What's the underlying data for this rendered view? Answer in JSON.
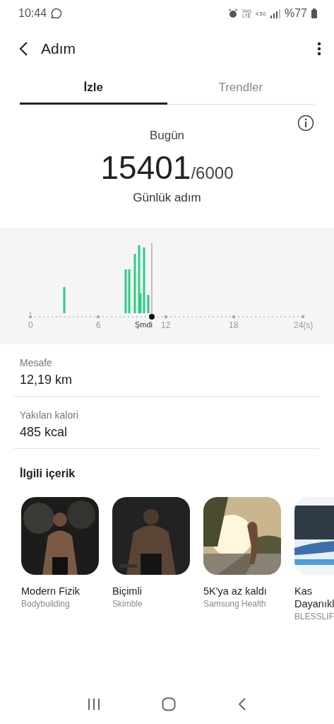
{
  "status_bar": {
    "time": "10:44",
    "indicators": [
      "Vo))",
      "LTE",
      "4.5G"
    ],
    "battery": "%77"
  },
  "header": {
    "title": "Adım"
  },
  "tabs": [
    {
      "label": "İzle",
      "selected": true
    },
    {
      "label": "Trendler",
      "selected": false
    }
  ],
  "summary": {
    "label": "Bugün",
    "steps": "15401",
    "goal": "/6000",
    "caption": "Günlük adım"
  },
  "chart": {
    "axis_labels": [
      "0",
      "6",
      "12",
      "18",
      "24(s)"
    ],
    "now_label": "Şmdi"
  },
  "stats": [
    {
      "label": "Mesafe",
      "value": "12,19 km"
    },
    {
      "label": "Yakılan kalori",
      "value": "485 kcal"
    }
  ],
  "related": {
    "title": "İlgili içerik",
    "items": [
      {
        "title": "Modern Fizik",
        "source": "Bodybuilding"
      },
      {
        "title": "Biçimli",
        "source": "Skimble"
      },
      {
        "title": "5K'ya az kaldı",
        "source": "Samsung Health"
      },
      {
        "title": "Kas Dayanıkl",
        "source": "BLESSLIF"
      }
    ]
  }
}
